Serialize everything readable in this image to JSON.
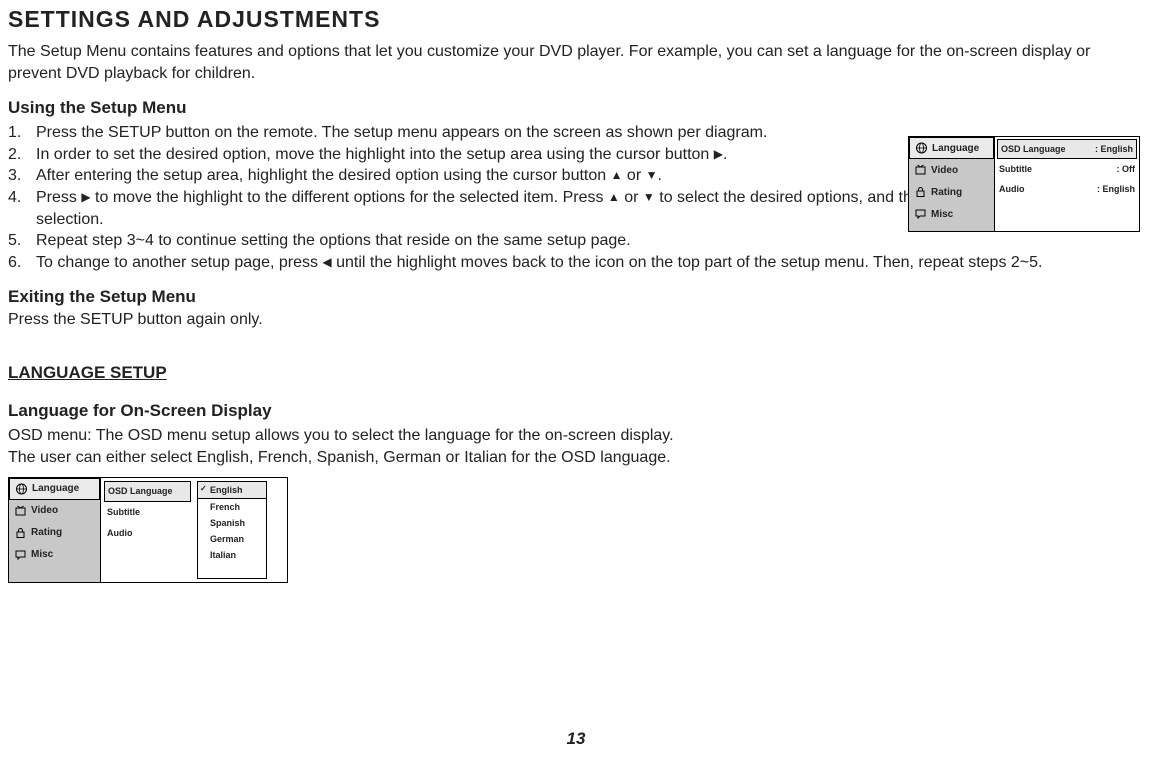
{
  "page_title": "SETTINGS AND ADJUSTMENTS",
  "intro": "The Setup Menu contains features and options that let you customize your DVD player. For example, you can set a language for the on-screen display or prevent DVD playback for children.",
  "using_heading": "Using the Setup Menu",
  "steps": {
    "s1": "Press the SETUP button on the remote. The setup menu appears on the screen as shown per diagram.",
    "s2a": "In order to set the desired option, move the highlight into the setup area using the cursor button ",
    "s2b": ".",
    "s3a": "After entering the setup area, highlight the desired option using the cursor button ",
    "s3b": " or ",
    "s3c": ".",
    "s4a": "Press ",
    "s4b": " to move the highlight to the different options for the selected item. Press ",
    "s4c": " or ",
    "s4d": " to select the desired options, and then press ENTER to confirm the selection.",
    "s5": "Repeat step 3~4 to continue setting the options that reside on the same setup page.",
    "s6a": "To change to another setup page, press ",
    "s6b": " until the highlight moves back to the icon on the top part of the setup menu. Then, repeat steps 2~5."
  },
  "exit_heading": "Exiting the Setup Menu",
  "exit_body": "Press the SETUP button again only.",
  "lang_setup_heading": "LANGUAGE SETUP",
  "lang_osd_heading": "Language for On-Screen Display",
  "lang_osd_body1": "OSD menu: The OSD menu setup allows you to select the language for the on-screen display.",
  "lang_osd_body2": "The user can either select English, French, Spanish, German or Italian for the OSD language.",
  "osd1": {
    "tabs": {
      "language": "Language",
      "video": "Video",
      "rating": "Rating",
      "misc": "Misc"
    },
    "rows": {
      "osd_lang_label": "OSD Language",
      "osd_lang_value": ": English",
      "subtitle_label": "Subtitle",
      "subtitle_value": ": Off",
      "audio_label": "Audio",
      "audio_value": ": English"
    }
  },
  "osd2": {
    "tabs": {
      "language": "Language",
      "video": "Video",
      "rating": "Rating",
      "misc": "Misc"
    },
    "mid": {
      "osd_lang": "OSD Language",
      "subtitle": "Subtitle",
      "audio": "Audio"
    },
    "options": {
      "english": "English",
      "french": "French",
      "spanish": "Spanish",
      "german": "German",
      "italian": "Italian"
    }
  },
  "page_number": "13"
}
